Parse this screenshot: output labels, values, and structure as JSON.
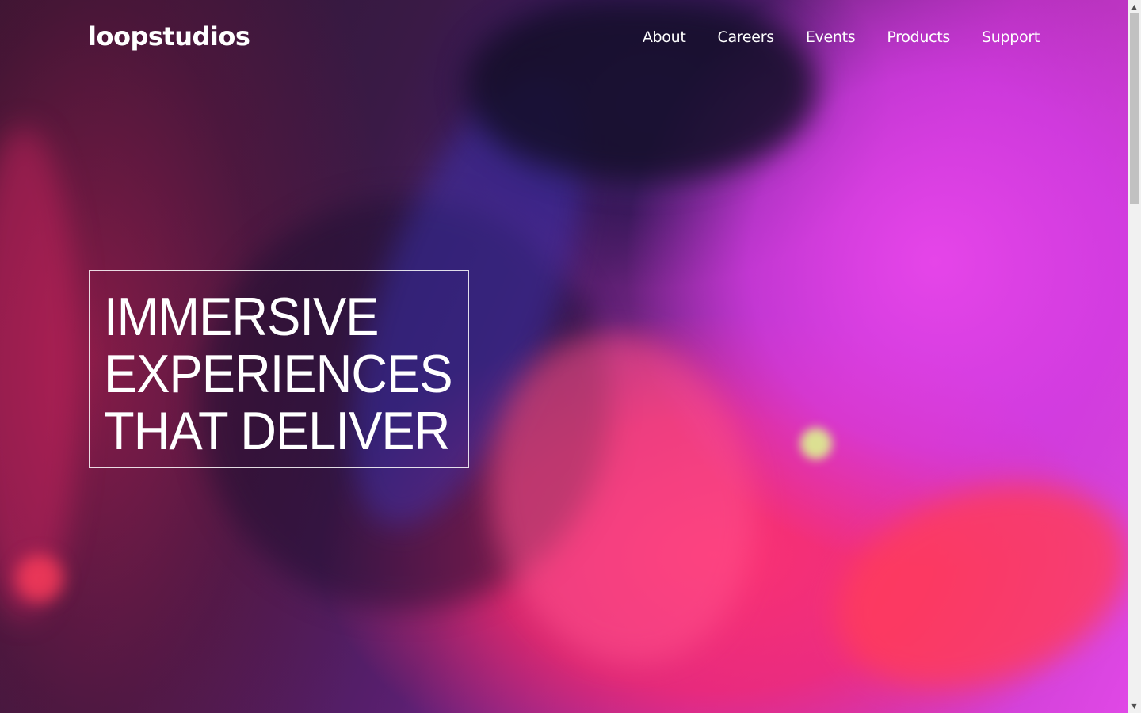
{
  "header": {
    "logo_text": "loopstudios",
    "nav": [
      {
        "label": "About"
      },
      {
        "label": "Careers"
      },
      {
        "label": "Events"
      },
      {
        "label": "Products"
      },
      {
        "label": "Support"
      }
    ]
  },
  "hero": {
    "headline_lines": [
      "IMMERSIVE",
      "EXPERIENCES",
      "THAT DELIVER"
    ],
    "background_image": "person-wearing-vr-headset-neon-lighting"
  },
  "scrollbar": {
    "up_icon": "scroll-up-arrow-icon",
    "down_icon": "scroll-down-arrow-icon"
  },
  "colors": {
    "text": "#ffffff",
    "magenta": "#e048e6",
    "pink_red": "#ff3070",
    "dark_purple": "#2a1630"
  }
}
